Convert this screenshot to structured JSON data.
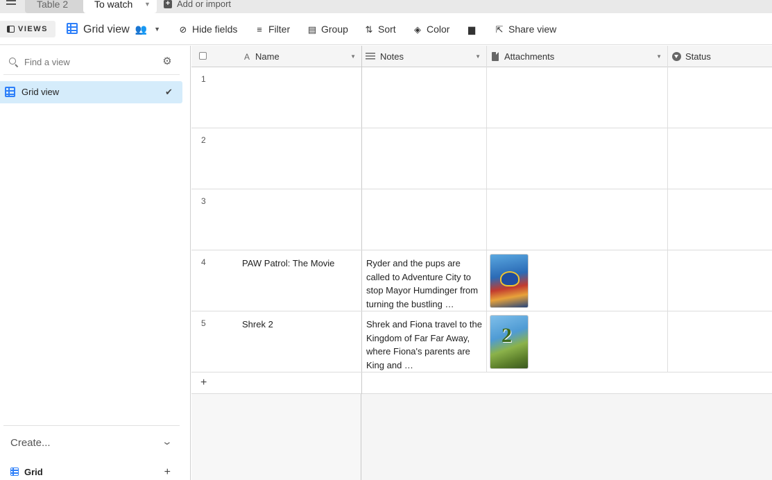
{
  "tabs": [
    {
      "label": "Table 2",
      "active": false
    },
    {
      "label": "To watch",
      "active": true
    }
  ],
  "add_import_label": "Add or import",
  "toolbar": {
    "views_label": "VIEWS",
    "view_name": "Grid view",
    "hide_fields": "Hide fields",
    "filter": "Filter",
    "group": "Group",
    "sort": "Sort",
    "color": "Color",
    "share_view": "Share view"
  },
  "sidebar": {
    "search_placeholder": "Find a view",
    "views": [
      {
        "label": "Grid view",
        "selected": true
      }
    ],
    "create_label": "Create...",
    "create_items": [
      {
        "label": "Grid"
      }
    ]
  },
  "grid": {
    "columns": [
      {
        "name": "Name",
        "icon": "text-icon"
      },
      {
        "name": "Notes",
        "icon": "long-text-icon"
      },
      {
        "name": "Attachments",
        "icon": "attachment-icon"
      },
      {
        "name": "Status",
        "icon": "single-select-icon"
      }
    ],
    "rows": [
      {
        "num": "1",
        "name": "",
        "notes": "",
        "attachment": null
      },
      {
        "num": "2",
        "name": "",
        "notes": "",
        "attachment": null
      },
      {
        "num": "3",
        "name": "",
        "notes": "",
        "attachment": null
      },
      {
        "num": "4",
        "name": "PAW Patrol: The Movie",
        "notes": "Ryder and the pups are called to Adventure City to stop Mayor Humdinger from turning the bustling …",
        "attachment": "paw-patrol-poster"
      },
      {
        "num": "5",
        "name": "Shrek 2",
        "notes": "Shrek and Fiona travel to the Kingdom of Far Far Away, where Fiona's parents are King and …",
        "attachment": "shrek-2-poster"
      }
    ]
  },
  "colors": {
    "accent": "#2d7ff9",
    "selected_view_bg": "#d5ecfb"
  }
}
